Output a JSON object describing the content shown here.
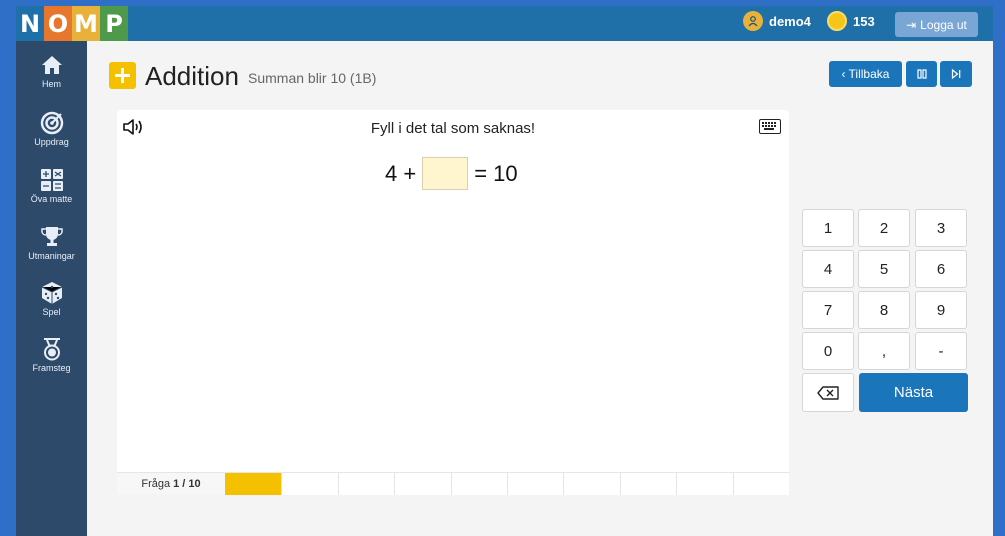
{
  "logo": {
    "letters": [
      {
        "char": "N",
        "color": "#1f6fa8"
      },
      {
        "char": "O",
        "color": "#e8772e"
      },
      {
        "char": "M",
        "color": "#e8b23a"
      },
      {
        "char": "P",
        "color": "#4e9a4a"
      }
    ]
  },
  "topbar": {
    "username": "demo4",
    "coins": "153",
    "logout_label": "Logga ut"
  },
  "sidebar": {
    "items": [
      {
        "label": "Hem",
        "icon": "home-icon"
      },
      {
        "label": "Uppdrag",
        "icon": "target-icon"
      },
      {
        "label": "Öva matte",
        "icon": "calculator-icon"
      },
      {
        "label": "Utmaningar",
        "icon": "trophy-icon"
      },
      {
        "label": "Spel",
        "icon": "dice-icon"
      },
      {
        "label": "Framsteg",
        "icon": "medal-icon"
      }
    ]
  },
  "header": {
    "title": "Addition",
    "subtitle": "Summan blir 10  (1B)",
    "back_label": "Tillbaka"
  },
  "exercise": {
    "prompt": "Fyll i det tal som saknas!",
    "operand": "4 +",
    "answer_value": "",
    "result": "= 10"
  },
  "progress": {
    "label": "Fråga",
    "current": "1 / 10",
    "total_segments": 10,
    "completed": 1
  },
  "keypad": {
    "keys": [
      "1",
      "2",
      "3",
      "4",
      "5",
      "6",
      "7",
      "8",
      "9",
      "0",
      ",",
      "-"
    ],
    "next_label": "Nästa"
  }
}
